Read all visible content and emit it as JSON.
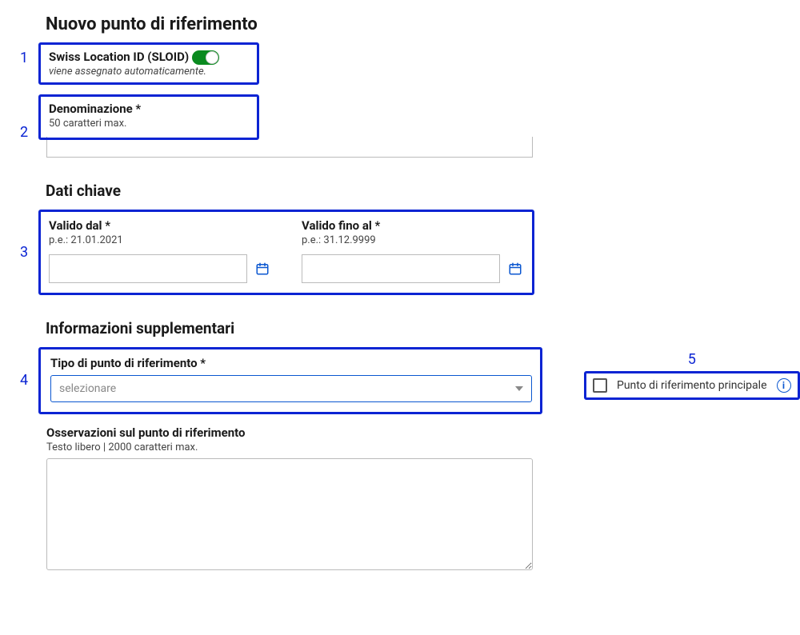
{
  "title": "Nuovo punto di riferimento",
  "annotations": {
    "n1": "1",
    "n2": "2",
    "n3": "3",
    "n4": "4",
    "n5": "5"
  },
  "sloid": {
    "label": "Swiss Location ID (SLOID)",
    "hint": "viene assegnato automaticamente.",
    "toggle_on": true
  },
  "denominazione": {
    "label": "Denominazione *",
    "hint": "50 caratteri max.",
    "value": ""
  },
  "dati_chiave": {
    "title": "Dati chiave",
    "valido_dal": {
      "label": "Valido dal *",
      "hint": "p.e.: 21.01.2021",
      "value": ""
    },
    "valido_fino": {
      "label": "Valido fino al *",
      "hint": "p.e.: 31.12.9999",
      "value": ""
    }
  },
  "info_supp": {
    "title": "Informazioni supplementari",
    "tipo": {
      "label": "Tipo di punto di riferimento *",
      "placeholder": "selezionare"
    },
    "osservazioni": {
      "label": "Osservazioni sul punto di riferimento",
      "hint": "Testo libero | 2000 caratteri max.",
      "value": ""
    }
  },
  "principale": {
    "label": "Punto di riferimento principale",
    "checked": false
  },
  "info_glyph": "i"
}
